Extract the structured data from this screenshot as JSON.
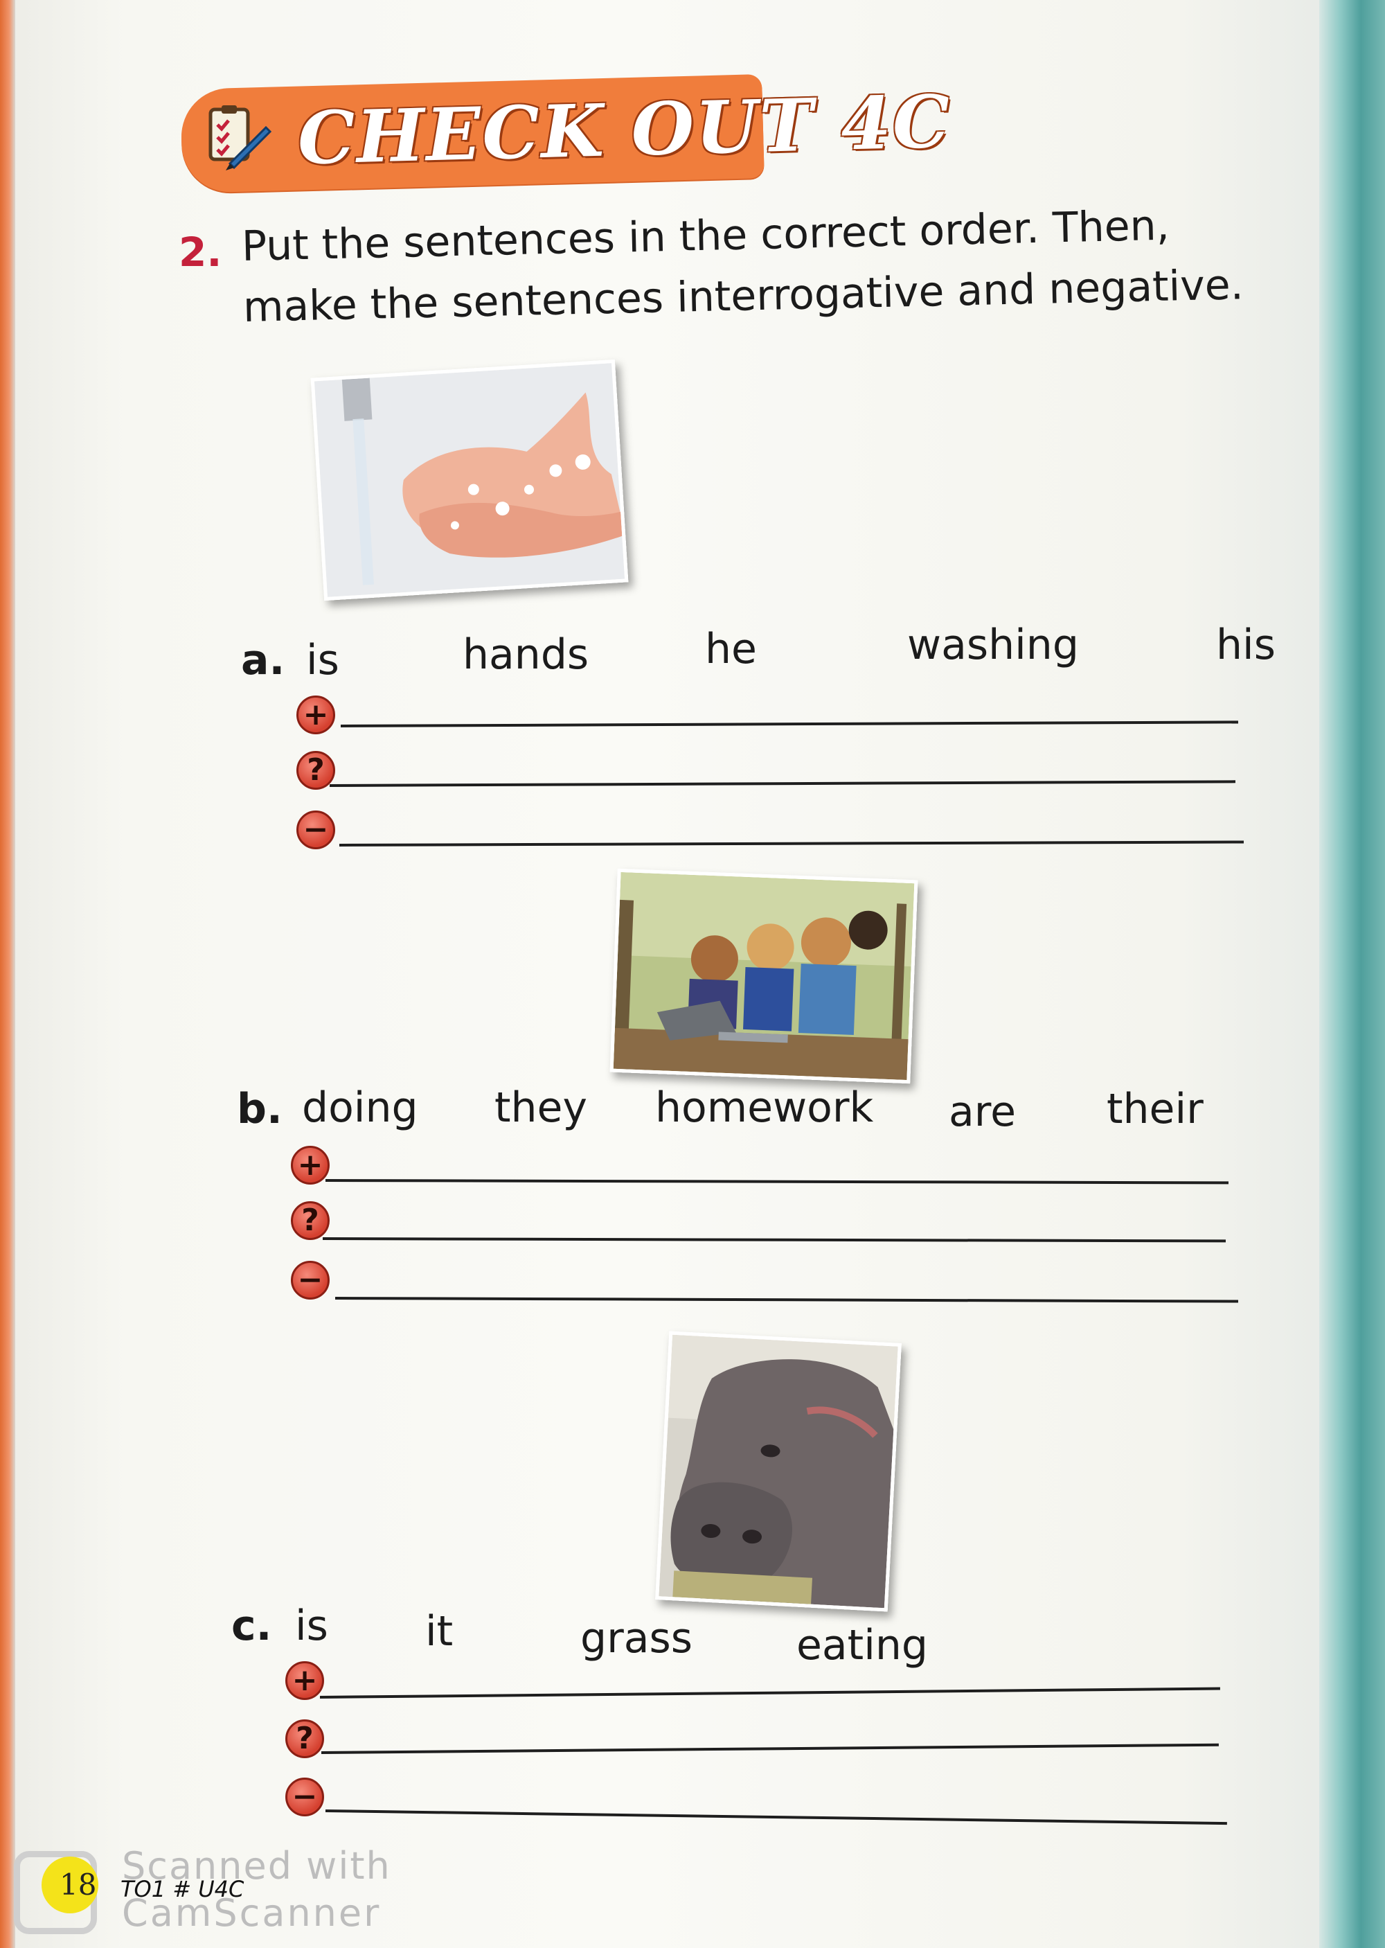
{
  "banner": {
    "title": "CHECK OUT 4C"
  },
  "instruction": {
    "number": "2.",
    "line1": "Put the sentences in the correct order. Then,",
    "line2": "make the sentences interrogative and negative."
  },
  "exercises": [
    {
      "letter": "a.",
      "words": [
        "is",
        "hands",
        "he",
        "washing",
        "his"
      ],
      "photo_icon": "hand-washing-photo"
    },
    {
      "letter": "b.",
      "words": [
        "doing",
        "they",
        "homework",
        "are",
        "their"
      ],
      "photo_icon": "girls-laptop-photo"
    },
    {
      "letter": "c.",
      "words": [
        "is",
        "it",
        "grass",
        "eating"
      ],
      "photo_icon": "hippo-photo"
    }
  ],
  "marks": {
    "positive": "+",
    "question": "?",
    "negative": "−"
  },
  "footer": {
    "page_number": "18",
    "code": "TO1 # U4C",
    "watermark_line1": "Scanned with",
    "watermark_line2": "CamScanner"
  },
  "colors": {
    "banner": "#f07d3c",
    "instruction_number": "#c4213b",
    "mark": "#d5402f",
    "teal_edge": "#4f9f9c"
  }
}
